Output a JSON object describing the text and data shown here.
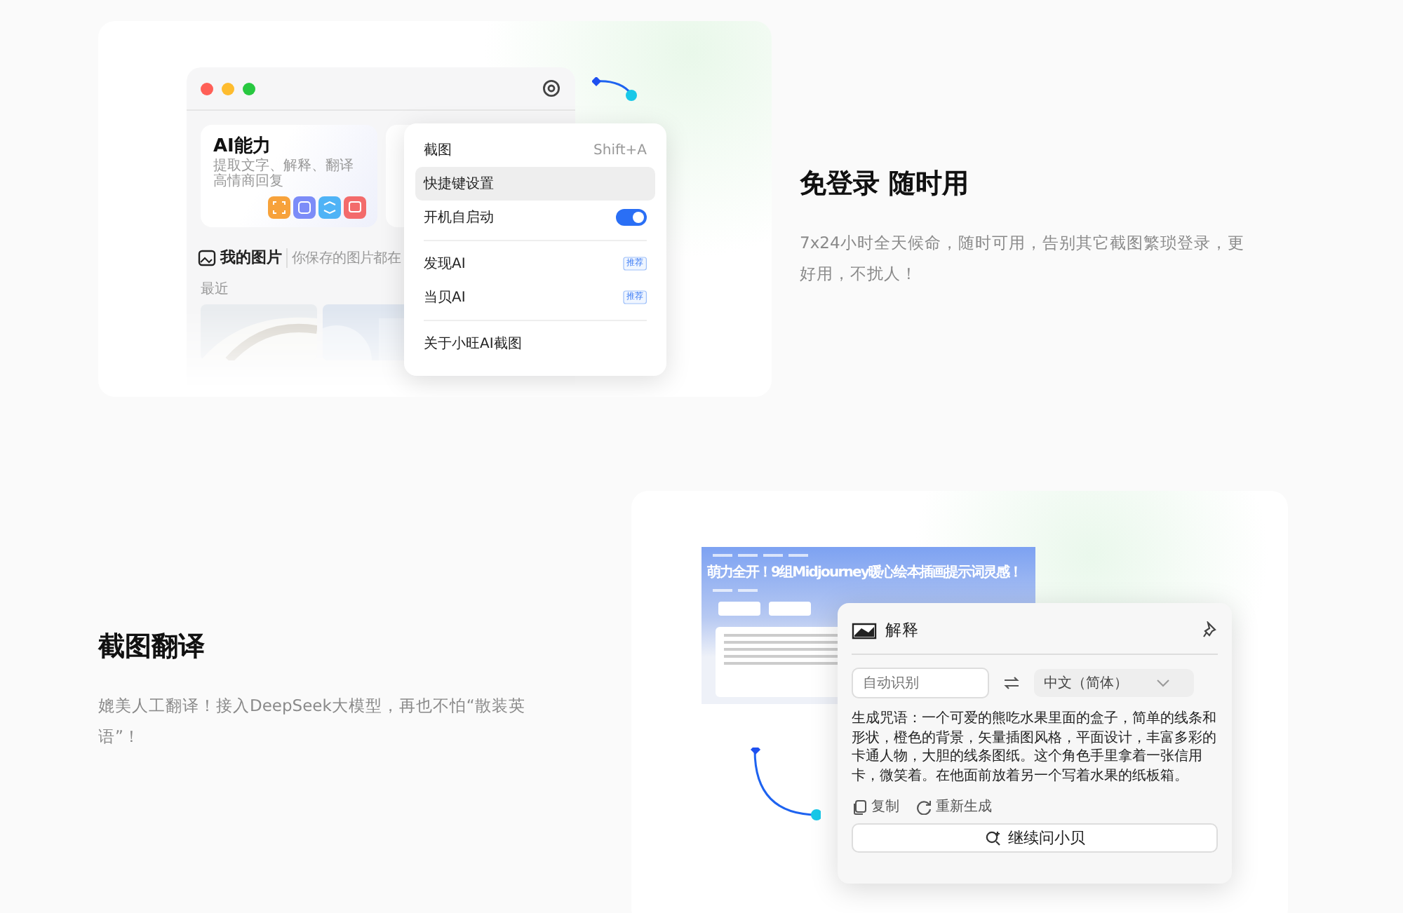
{
  "menu_demo": {
    "window": {
      "cards": [
        {
          "title": "AI能力",
          "lines": [
            "提取文字、解释、翻译",
            "高情商回复"
          ],
          "apps": [
            {
              "color": "#f7a23b"
            },
            {
              "color": "#7c8cf8"
            },
            {
              "color": "#4fb3f6"
            },
            {
              "color": "#f36b6b"
            }
          ]
        }
      ],
      "section": {
        "title": "我的图片",
        "hint": "你保存的图片都在"
      },
      "recent_label": "最近"
    },
    "menu": {
      "items": [
        {
          "kind": "command",
          "label": "截图",
          "shortcut": "Shift+A",
          "selected": false
        },
        {
          "kind": "command",
          "label": "快捷键设置",
          "selected": true
        },
        {
          "kind": "toggle",
          "label": "开机自启动",
          "on": true
        },
        {
          "kind": "separator"
        },
        {
          "kind": "badge",
          "label": "发现AI",
          "badge": "推荐"
        },
        {
          "kind": "badge",
          "label": "当贝AI",
          "badge": "推荐"
        },
        {
          "kind": "separator"
        },
        {
          "kind": "command",
          "label": "关于小旺AI截图",
          "selected": false
        }
      ]
    }
  },
  "feature_login": {
    "title": "免登录 随时用",
    "description": "7x24小时全天候命，随时可用，告别其它截图繁琐登录，更好用，不扰人！"
  },
  "feature_translate": {
    "title": "截图翻译",
    "description": "媲美人工翻译！接入DeepSeek大模型，再也不怕“散装英语”！"
  },
  "translate_demo": {
    "article": {
      "title": "萌力全开！9组Midjourney暖心绘本插画提示词灵感！"
    },
    "popup": {
      "title": "解释",
      "source_placeholder": "自动识别",
      "target_language": "中文（简体）",
      "result": "生成咒语：一个可爱的熊吃水果里面的盒子，简单的线条和形状，橙色的背景，矢量插图风格，平面设计，丰富多彩的卡通人物，大胆的线条图纸。这个角色手里拿着一张信用卡，微笑着。在他面前放着另一个写着水果的纸板箱。",
      "actions": [
        {
          "kind": "copy",
          "label": "复制"
        },
        {
          "kind": "regenerate",
          "label": "重新生成"
        }
      ],
      "ask_button": "继续问小贝"
    }
  }
}
